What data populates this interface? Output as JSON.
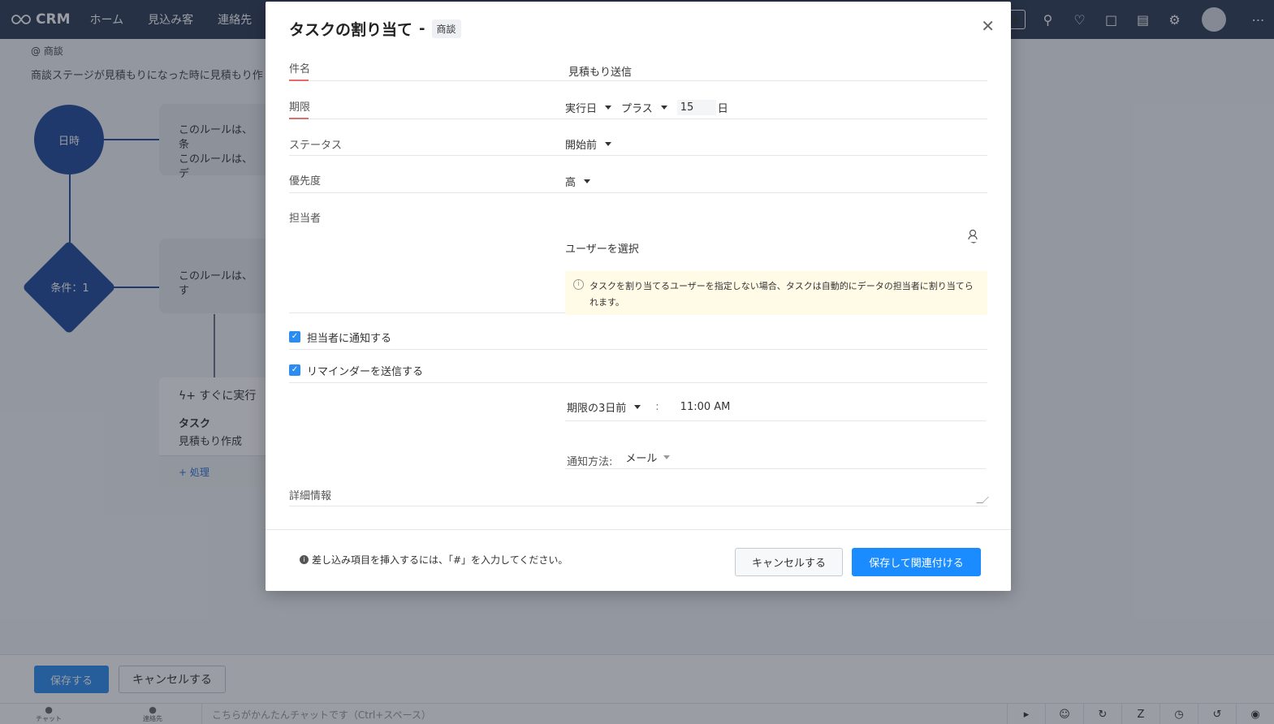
{
  "topnav": {
    "app_name": "CRM",
    "links": [
      "ホーム",
      "見込み客",
      "連絡先"
    ]
  },
  "background": {
    "breadcrumb": "@ 商談",
    "description": "商談ステージが見積もりになった時に見積もり作",
    "trigger_node": "日時",
    "rule_card_1_line1": "このルールは、条",
    "rule_card_1_line2": "このルールは、デ",
    "condition_node": "条件：1",
    "rule_card_2": "このルールは、す",
    "action_card": {
      "header": "すぐに実行",
      "type": "タスク",
      "name": "見積もり作成",
      "add_action": "+ 処理"
    },
    "save_button": "保存する",
    "cancel_button": "キャンセルする"
  },
  "chatbar": {
    "tab_chat": "チャット",
    "tab_contacts": "連絡先",
    "placeholder": "こちらがかんたんチャットです（Ctrl+スペース）"
  },
  "modal": {
    "title": "タスクの割り当て",
    "module_tag": "商談",
    "fields": {
      "subject_label": "件名",
      "subject_value": "見積もり送信",
      "due_label": "期限",
      "due_base": "実行日",
      "due_op": "プラス",
      "due_days": "15",
      "due_unit": "日",
      "status_label": "ステータス",
      "status_value": "開始前",
      "priority_label": "優先度",
      "priority_value": "高",
      "owner_label": "担当者",
      "owner_placeholder": "ユーザーを選択",
      "owner_info": "タスクを割り当てるユーザーを指定しない場合、タスクは自動的にデータの担当者に割り当てられます。",
      "notify_owner_label": "担当者に通知する",
      "reminder_label": "リマインダーを送信する",
      "reminder_when": "期限の3日前",
      "reminder_sep": ":",
      "reminder_time": "11:00  AM",
      "notify_method_label": "通知方法:",
      "notify_method_value": "メール",
      "details_label": "詳細情報"
    },
    "footer": {
      "hint": "差し込み項目を挿入するには、「#」を入力してください。",
      "cancel": "キャンセルする",
      "save_associate": "保存して関連付ける"
    }
  }
}
